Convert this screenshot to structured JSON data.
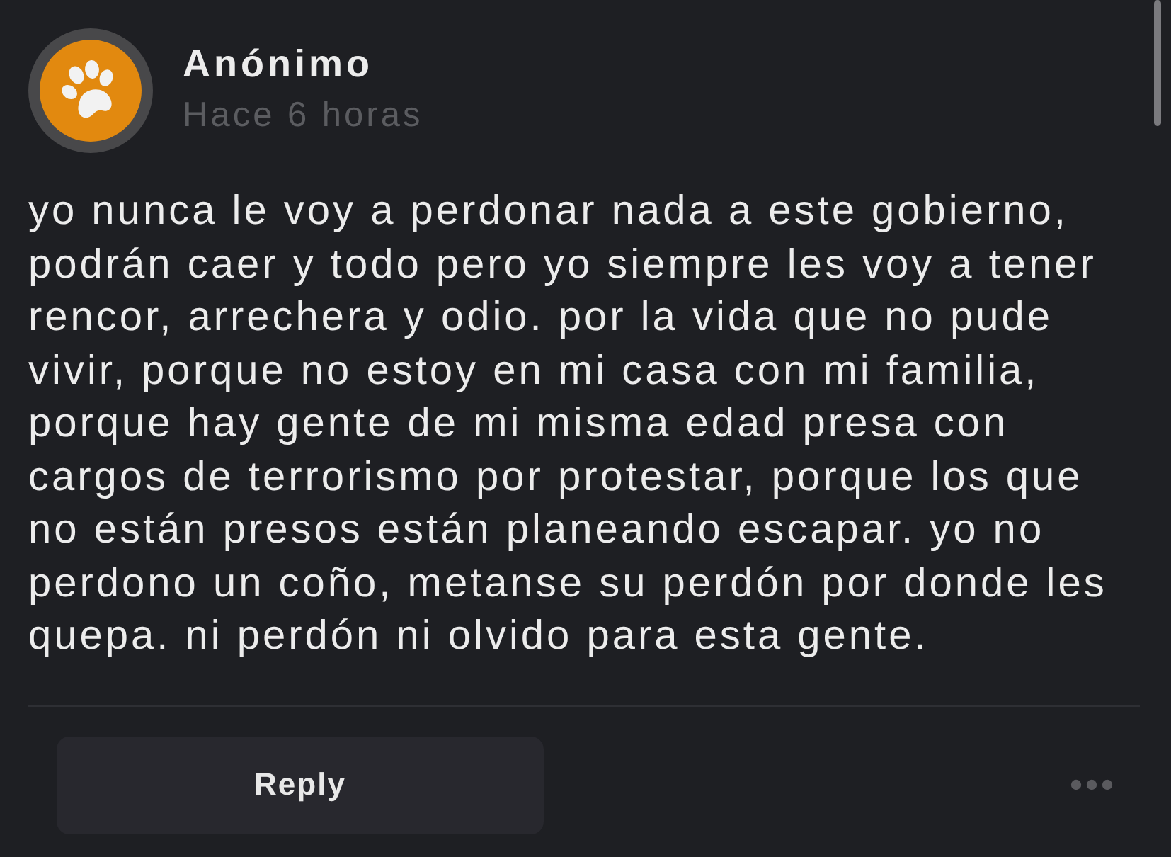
{
  "comment": {
    "author": "Anónimo",
    "time": "Hace 6 horas",
    "body_lines": [
      "yo nunca le voy a perdonar nada a este gobierno,",
      "podrán caer y todo pero yo siempre les voy a tener",
      "rencor, arrechera y odio. por la vida que no pude",
      "vivir, porque no estoy en mi casa con mi familia,",
      "porque hay gente de mi misma edad presa con",
      "cargos de terrorismo por protestar, porque los que",
      "no están presos están planeando escapar. yo no",
      "perdono un coño, metanse su perdón por donde les",
      "quepa. ni perdón ni olvido para esta gente."
    ]
  },
  "actions": {
    "reply_button": "Reply"
  }
}
